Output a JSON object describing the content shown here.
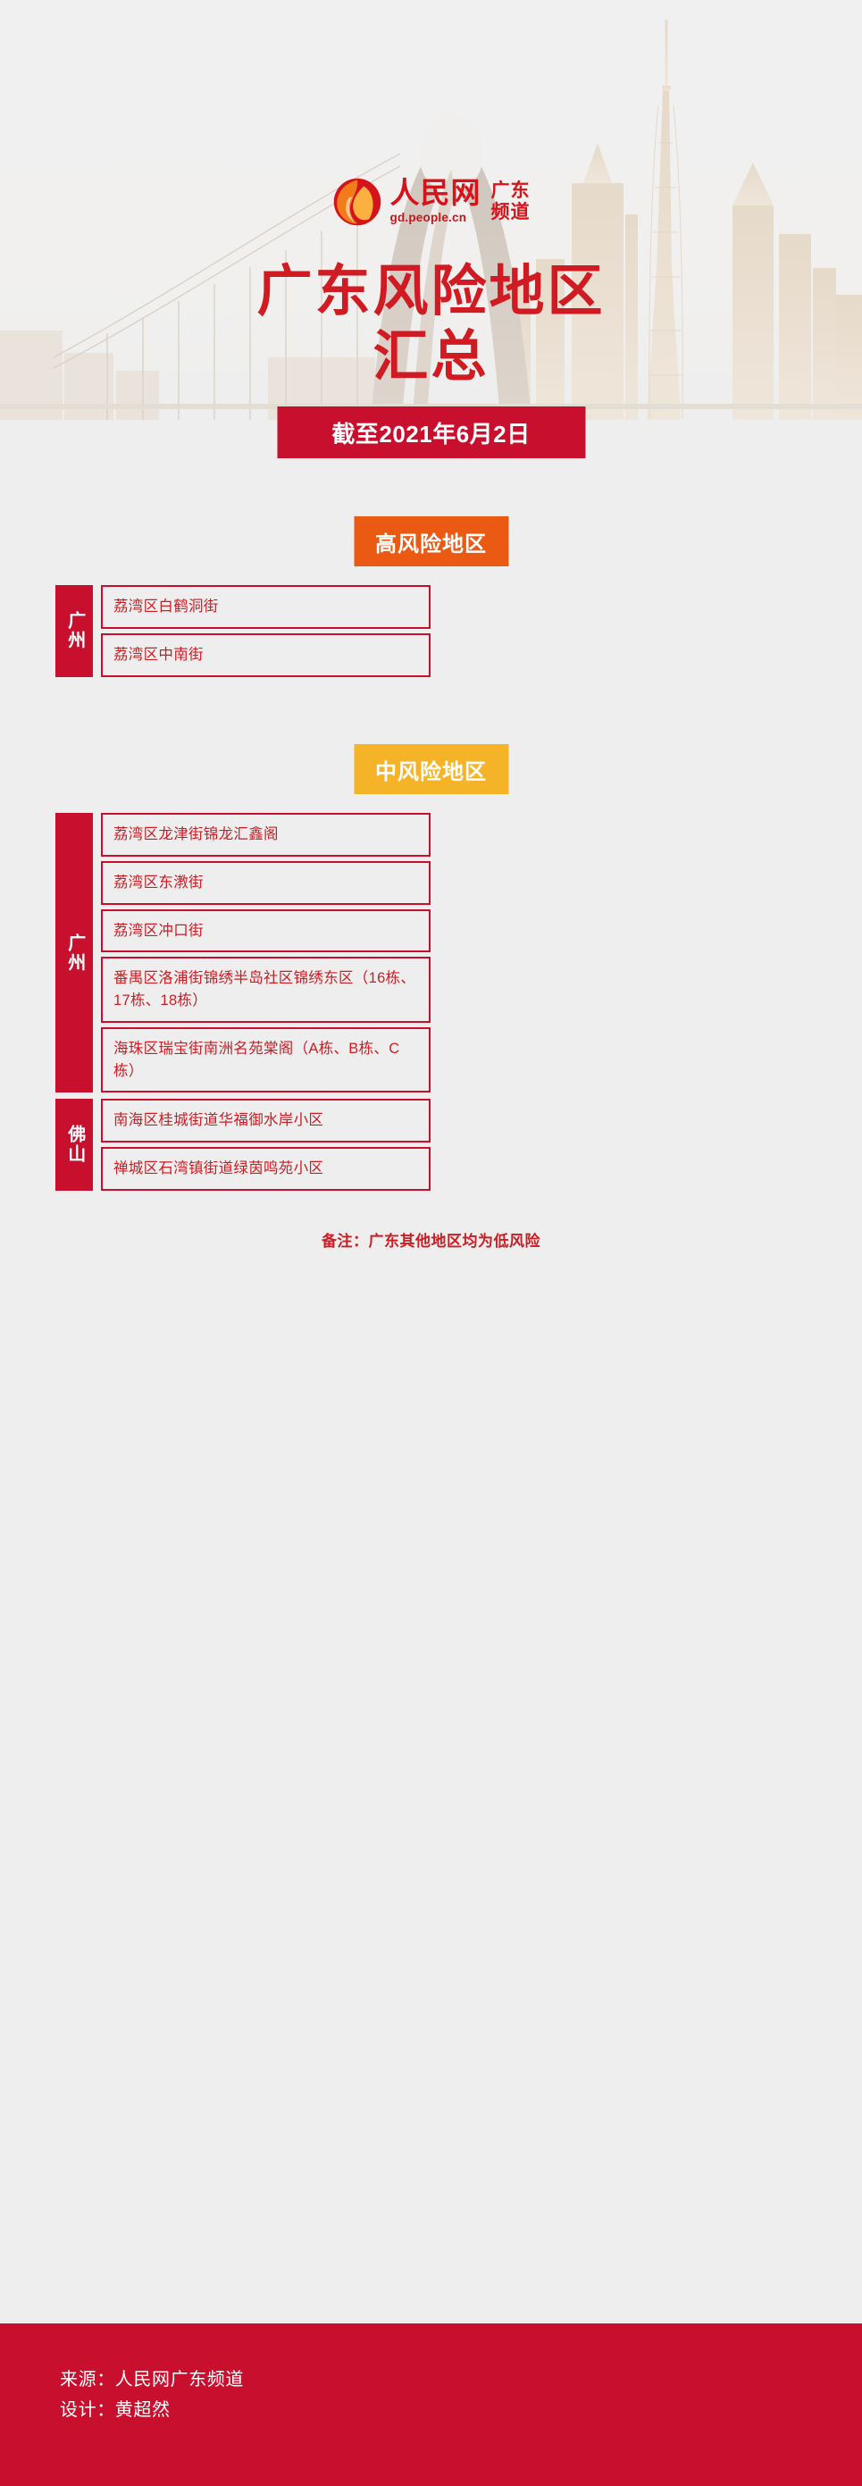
{
  "brand": {
    "logo_mark": "people-cn-flame-logo",
    "name_cn": "人民网",
    "url": "gd.people.cn",
    "channel_line1": "广东",
    "channel_line2": "频道"
  },
  "title": {
    "line1": "广东风险地区",
    "line2": "汇总"
  },
  "date_banner": {
    "label": "截至2021年6月2日"
  },
  "sections": [
    {
      "key": "high",
      "chip_label": "高风险地区",
      "chip_color": "#ea5a13",
      "groups": [
        {
          "label": "广州",
          "rows": [
            {
              "text": "荔湾区白鹤洞街",
              "lines": 1
            },
            {
              "text": "荔湾区中南街",
              "lines": 1
            }
          ]
        }
      ]
    },
    {
      "key": "medium",
      "chip_label": "中风险地区",
      "chip_color": "#f5b427",
      "groups": [
        {
          "label": "广州",
          "rows": [
            {
              "text": "荔湾区龙津街锦龙汇鑫阁",
              "lines": 1
            },
            {
              "text": "荔湾区东漖街",
              "lines": 1
            },
            {
              "text": "荔湾区冲口街",
              "lines": 1
            },
            {
              "text": "番禺区洛浦街锦绣半岛社区锦绣东区（16栋、17栋、18栋）",
              "lines": 2
            },
            {
              "text": "海珠区瑞宝街南洲名苑棠阁（A栋、B栋、C栋）",
              "lines": 1
            }
          ]
        },
        {
          "label": "佛山",
          "rows": [
            {
              "text": "南海区桂城街道华福御水岸小区",
              "lines": 1
            },
            {
              "text": "禅城区石湾镇街道绿茵鸣苑小区",
              "lines": 1
            }
          ]
        }
      ]
    }
  ],
  "note": {
    "text": "备注：广东其他地区均为低风险"
  },
  "footer": {
    "source": "来源：人民网广东频道",
    "designer": "设计：黄超然"
  },
  "colors": {
    "brand_red": "#c8102e",
    "title_red": "#d01b22",
    "high_risk_orange": "#ea5a13",
    "mid_risk_yellow": "#f5b427",
    "row_text_red": "#cc1d24",
    "background": "#eeeeee"
  }
}
